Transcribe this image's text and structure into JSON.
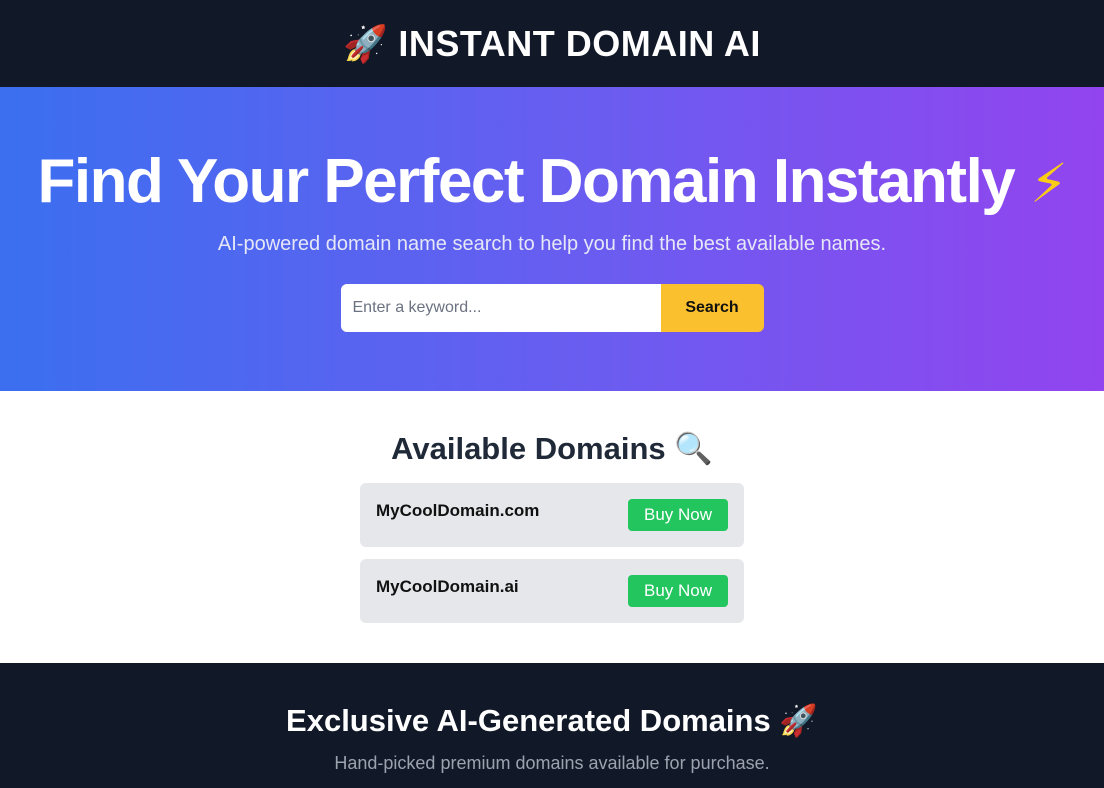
{
  "header": {
    "icon": "rocket-icon",
    "icon_glyph": "🚀",
    "title": "INSTANT DOMAIN AI"
  },
  "hero": {
    "title": "Find Your Perfect Domain Instantly",
    "title_icon": "lightning-icon",
    "title_icon_glyph": "⚡",
    "subtitle": "AI-powered domain name search to help you find the best available names.",
    "search": {
      "placeholder": "Enter a keyword...",
      "value": "",
      "button_label": "Search"
    }
  },
  "available": {
    "title": "Available Domains",
    "title_icon": "magnifier-icon",
    "title_icon_glyph": "🔍",
    "domains": [
      {
        "name": "MyCoolDomain.com",
        "button_label": "Buy Now"
      },
      {
        "name": "MyCoolDomain.ai",
        "button_label": "Buy Now"
      }
    ]
  },
  "exclusive": {
    "title": "Exclusive AI-Generated Domains",
    "title_icon": "rocket-icon",
    "title_icon_glyph": "🚀",
    "subtitle": "Hand-picked premium domains available for purchase."
  },
  "colors": {
    "header_bg": "#111827",
    "gradient_start": "#3b6ff0",
    "gradient_end": "#9244ee",
    "search_button": "#fbc02d",
    "buy_button": "#22c55e",
    "card_bg": "#e5e7eb"
  }
}
